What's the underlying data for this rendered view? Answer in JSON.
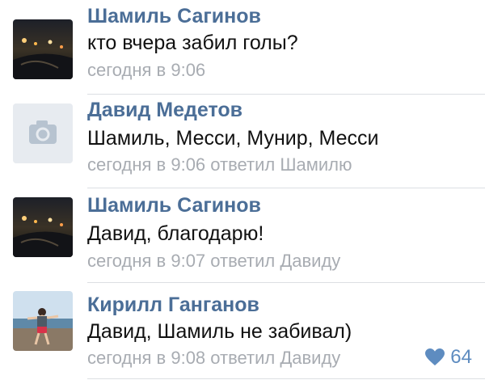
{
  "comments": [
    {
      "author": "Шамиль Сагинов",
      "text": "кто вчера забил голы?",
      "meta": "сегодня в 9:06",
      "avatar_icon": "night-road-photo"
    },
    {
      "author": "Давид Медетов",
      "text": "Шамиль, Месси, Мунир, Месси",
      "meta": "сегодня в 9:06 ответил Шамилю",
      "avatar_icon": "camera-icon"
    },
    {
      "author": "Шамиль Сагинов",
      "text": "Давид, благодарю!",
      "meta": "сегодня в 9:07 ответил Давиду",
      "avatar_icon": "night-road-photo"
    },
    {
      "author": "Кирилл Ганганов",
      "text": "Давид, Шамиль не забивал)",
      "meta": "сегодня в 9:08 ответил Давиду",
      "avatar_icon": "beach-person-photo",
      "likes": "64"
    }
  ],
  "colors": {
    "author": "#4b6e97",
    "meta": "#a8acb2",
    "like": "#5e8cc0"
  }
}
